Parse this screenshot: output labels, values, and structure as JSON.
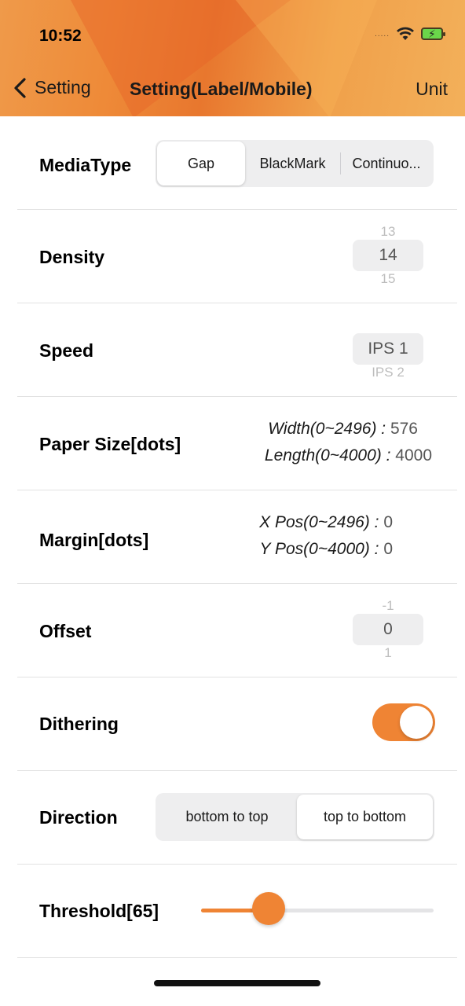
{
  "status": {
    "time": "10:52",
    "signal_dots": "....."
  },
  "nav": {
    "back_label": "Setting",
    "title": "Setting(Label/Mobile)",
    "right_label": "Unit"
  },
  "media_type": {
    "label": "MediaType",
    "options": [
      "Gap",
      "BlackMark",
      "Continuo..."
    ],
    "selected": "Gap"
  },
  "density": {
    "label": "Density",
    "prev": "13",
    "value": "14",
    "next": "15"
  },
  "speed": {
    "label": "Speed",
    "value": "IPS 1",
    "next": "IPS 2"
  },
  "paper_size": {
    "label": "Paper Size[dots]",
    "width_label": "Width(0~2496) :",
    "width_value": "576",
    "length_label": "Length(0~4000) :",
    "length_value": "4000"
  },
  "margin": {
    "label": "Margin[dots]",
    "x_label": "X Pos(0~2496) :",
    "x_value": "0",
    "y_label": "Y Pos(0~4000) :",
    "y_value": "0"
  },
  "offset": {
    "label": "Offset",
    "prev": "-1",
    "value": "0",
    "next": "1"
  },
  "dithering": {
    "label": "Dithering",
    "on": true
  },
  "direction": {
    "label": "Direction",
    "options": [
      "bottom to top",
      "top to bottom"
    ],
    "selected": "top to bottom"
  },
  "threshold": {
    "label": "Threshold[65]",
    "level_fraction": 0.29
  },
  "colors": {
    "accent": "#ef8434",
    "header_gradient_start": "#ef9a4a",
    "header_gradient_end": "#f3b05a"
  }
}
